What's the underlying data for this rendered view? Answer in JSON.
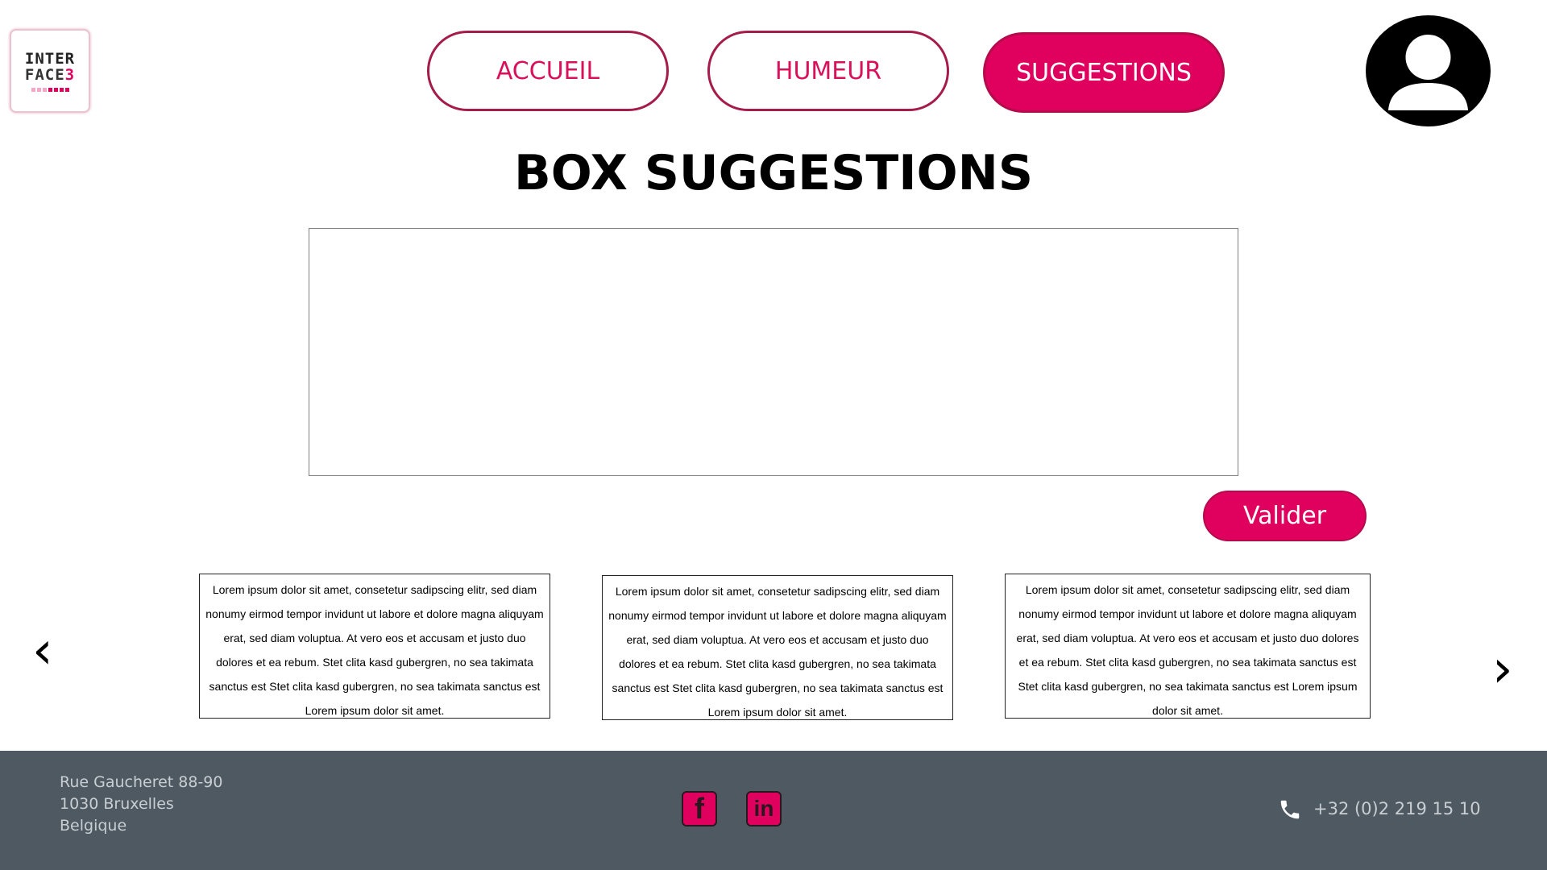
{
  "brand": {
    "logo_line1": "INTER",
    "logo_line2": "FACE",
    "logo_line2_suffix": "3"
  },
  "nav": {
    "items": [
      {
        "label": "ACCUEIL",
        "active": false
      },
      {
        "label": "HUMEUR",
        "active": false
      },
      {
        "label": "SUGGESTIONS",
        "active": true
      }
    ]
  },
  "main": {
    "title": "BOX SUGGESTIONS",
    "textarea_value": "",
    "submit_label": "Valider"
  },
  "carousel": {
    "prev_glyph": "‹",
    "next_glyph": "›",
    "cards": [
      {
        "text": "Lorem ipsum dolor sit amet, consetetur sadipscing elitr, sed diam nonumy eirmod tempor invidunt ut labore et dolore magna aliquyam erat, sed diam voluptua. At vero eos et accusam et justo duo dolores et ea rebum. Stet clita kasd gubergren, no sea takimata sanctus est Stet clita kasd gubergren, no sea takimata sanctus est Lorem ipsum dolor sit amet."
      },
      {
        "text": "Lorem ipsum dolor sit amet, consetetur sadipscing elitr, sed diam nonumy eirmod tempor invidunt ut labore et dolore magna aliquyam erat, sed diam voluptua. At vero eos et accusam et justo duo dolores et ea rebum. Stet clita kasd gubergren, no sea takimata sanctus est Stet clita kasd gubergren, no sea takimata sanctus est Lorem ipsum dolor sit amet."
      },
      {
        "text": "Lorem ipsum dolor sit amet, consetetur sadipscing elitr, sed diam nonumy eirmod tempor invidunt ut labore et dolore magna aliquyam erat, sed diam voluptua. At vero eos et accusam et justo duo dolores et ea rebum. Stet clita kasd gubergren, no sea takimata sanctus est Stet clita kasd gubergren, no sea takimata sanctus est Lorem ipsum dolor sit amet."
      }
    ]
  },
  "footer": {
    "address_line1": "Rue Gaucheret 88-90",
    "address_line2": "1030 Bruxelles",
    "address_line3": "Belgique",
    "facebook_glyph": "f",
    "linkedin_glyph": "in",
    "phone": "+32 (0)2 219 15 10",
    "icons": [
      "facebook-icon",
      "linkedin-icon",
      "phone-icon"
    ]
  },
  "colors": {
    "accent": "#e0005e",
    "nav_border": "#a51c4a",
    "footer_bg": "#4e5962",
    "footer_text": "#c9ced2"
  }
}
